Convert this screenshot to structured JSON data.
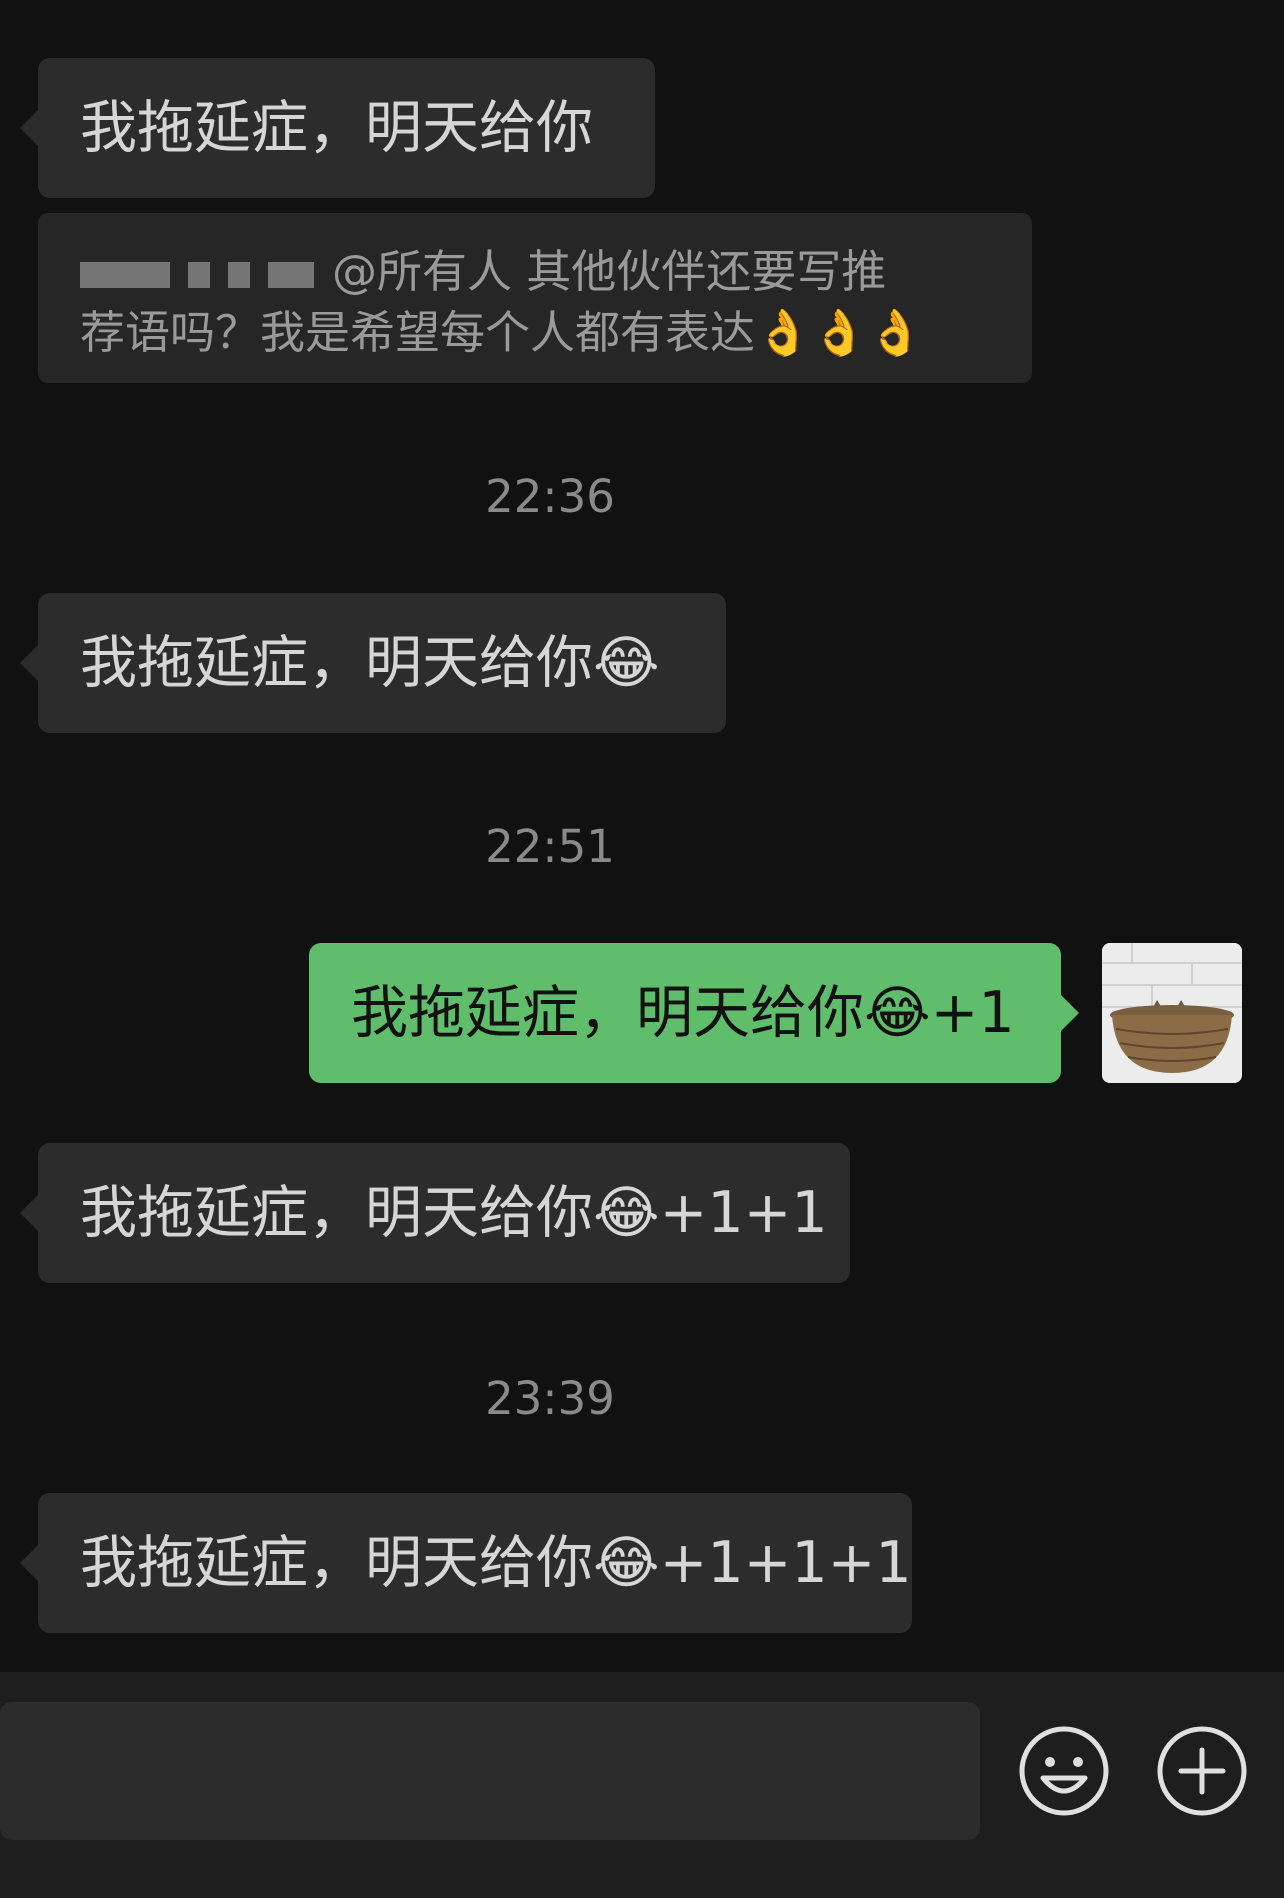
{
  "messages": [
    {
      "text": "我拖延症，明天给你",
      "emoji": "",
      "suffix": ""
    },
    {
      "text": "我拖延症，明天给你",
      "emoji": "😂",
      "suffix": ""
    },
    {
      "text": "我拖延症，明天给你",
      "emoji": "😂",
      "suffix": "+1"
    },
    {
      "text": "我拖延症，明天给你",
      "emoji": "😂",
      "suffix": "+1+1"
    },
    {
      "text": "我拖延症，明天给你",
      "emoji": "😂",
      "suffix": "+1+1+1"
    }
  ],
  "quote": {
    "line1": "@所有人 其他伙伴还要写推",
    "line2": "荐语吗？我是希望每个人都有表达",
    "emojis": "👌👌👌"
  },
  "timestamps": [
    "22:36",
    "22:51",
    "23:39"
  ],
  "input": {
    "placeholder": "",
    "value": ""
  },
  "icons": {
    "emoji_button": "smiley-icon",
    "more_button": "plus-circle-icon"
  },
  "colors": {
    "background": "#111111",
    "incoming_bubble": "#2c2c2c",
    "outgoing_bubble": "#5fbd6c"
  }
}
